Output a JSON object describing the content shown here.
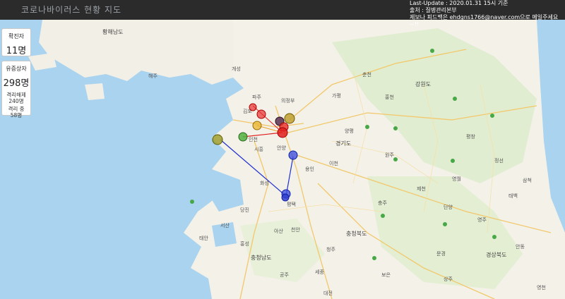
{
  "header": {
    "title": "코로나바이러스 현황 지도",
    "update_line1": "Last-Update : 2020.01.31 15시 기준",
    "update_line2": "출처 : 질병관리본부",
    "update_line3": "제보나 피드백은 ehdgns1766@naver.com으로 메일주세요~!!"
  },
  "stats": {
    "confirmed_label": "확진자",
    "confirmed_value": "11명",
    "suspected_label": "유증상자",
    "suspected_value": "298명",
    "released_label": "격리해제",
    "released_value": "240명",
    "isolating_label": "격리 중",
    "isolating_value": "58명"
  },
  "map_labels": {
    "hwanghae": "황해남도",
    "gangwon": "강원도",
    "gyeonggi": "경기도",
    "chungbuk": "충청북도",
    "chungnam": "충청남도",
    "gyeongbuk": "경상북도",
    "gimpo": "김포",
    "paju": "파주",
    "uijeongbu": "의정부",
    "incheon": "인천",
    "siheung": "시흥",
    "anyang": "안양",
    "hwaseong": "화성",
    "pyeongtaek": "평택",
    "cheonan": "천안",
    "asan": "아산",
    "yongin": "용인",
    "icheon": "이천",
    "chuncheon": "춘천",
    "wonju": "원주",
    "chungju": "충주",
    "cheongju": "청주",
    "sejong": "세종",
    "daejeon": "대전",
    "gapyeong": "가평",
    "hongcheon": "홍천",
    "yangpyeong": "양평",
    "gaesong": "개성",
    "gimpo_airport": "김포",
    "dangjin": "당진",
    "seosan": "서산",
    "hongseong": "홍성",
    "yeongwol": "영월",
    "jecheon": "제천",
    "danyang": "단양",
    "yeongju": "영주",
    "andong": "안동",
    "sangju": "상주",
    "mungyeong": "문경",
    "boeun": "보은",
    "gongju": "공주",
    "taean": "태안",
    "haeju": "해주",
    "pyeongchang": "평창",
    "jeongseon": "정선",
    "samcheok": "삼척",
    "taebaek": "태백",
    "yeongcheon": "영천"
  }
}
